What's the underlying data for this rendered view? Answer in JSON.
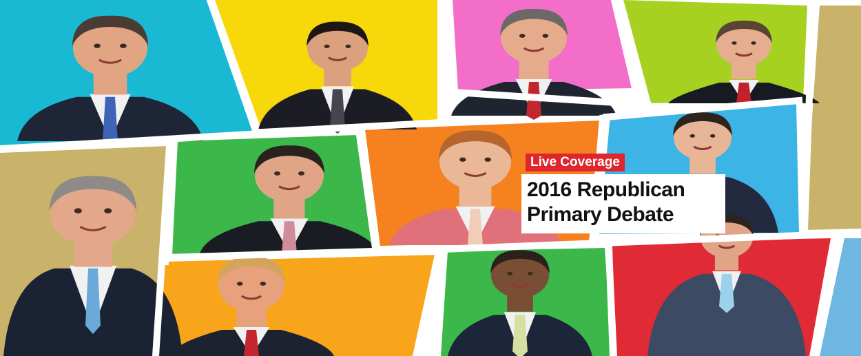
{
  "badge": {
    "label": "Live Coverage",
    "color": "#e0262d"
  },
  "title": {
    "line1": "2016 Republican",
    "line2": "Primary Debate"
  },
  "panel_colors": {
    "cyan": "#19b9d4",
    "yellow": "#f7d80a",
    "pink": "#f26ec8",
    "lime": "#a6d121",
    "tan": "#c9b36a",
    "green": "#3cb84a",
    "orange": "#f5811f",
    "sky": "#3cb4e6",
    "amber": "#f8a51b",
    "red": "#e02a35",
    "light_blue": "#6db7e0"
  },
  "figures": [
    {
      "name": "man-smiling-blue-tie",
      "skin": "#e2a583",
      "hair": "#4a3c34",
      "suit": "#1d2536",
      "tie": "#3f63b5"
    },
    {
      "name": "man-dark-hair-gray-tie",
      "skin": "#dba07e",
      "hair": "#1e1612",
      "suit": "#1c1c24",
      "tie": "#45454f"
    },
    {
      "name": "man-glasses-red-tie",
      "skin": "#e5ab8c",
      "hair": "#6b6866",
      "suit": "#1e2430",
      "tie": "#c2262f"
    },
    {
      "name": "man-pointing-red-tie",
      "skin": "#e6ad8e",
      "hair": "#5a4535",
      "suit": "#181a22",
      "tie": "#c0212c"
    },
    {
      "name": "man-smiling-dark-suit",
      "skin": "#e9b597",
      "hair": "#2d241e",
      "suit": "#232a40",
      "tie": "#c2262f"
    },
    {
      "name": "man-gray-hair-light-blue-tie",
      "skin": "#e3a789",
      "hair": "#8d8a88",
      "suit": "#1b2234",
      "tie": "#6aa9d8"
    },
    {
      "name": "man-dark-suit-pink-tie",
      "skin": "#e0a586",
      "hair": "#2a221e",
      "suit": "#1a1c24",
      "tie": "#d08c9a"
    },
    {
      "name": "woman-pink-jacket",
      "skin": "#eab797",
      "hair": "#b6662d",
      "suit": "#e0707a",
      "tie": "#f1cdb7"
    },
    {
      "name": "man-blond-hair-red-tie",
      "skin": "#e8a17d",
      "hair": "#d4a45c",
      "suit": "#1d2230",
      "tie": "#c2262f"
    },
    {
      "name": "man-glasses-striped-tie",
      "skin": "#7a4d35",
      "hair": "#2a211d",
      "suit": "#1d2538",
      "tie": "#d6dfa0"
    },
    {
      "name": "man-gesturing-light-blue-tie",
      "skin": "#e2a486",
      "hair": "#2d2420",
      "suit": "#3d4a63",
      "tie": "#9bd1ea"
    }
  ]
}
